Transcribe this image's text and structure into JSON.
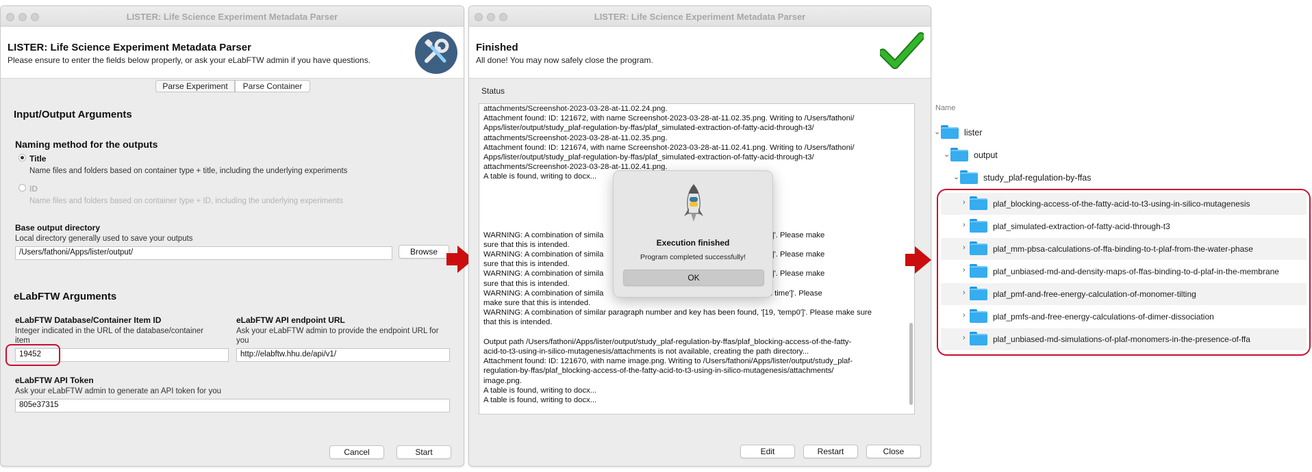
{
  "left_window": {
    "title": "LISTER: Life Science Experiment Metadata Parser",
    "header_title": "LISTER: Life Science Experiment Metadata Parser",
    "header_subtitle": "Please ensure to enter the fields below properly, or ask your eLabFTW admin if you have questions.",
    "tabs": [
      "Parse Experiment",
      "Parse Container"
    ],
    "io_section": "Input/Output Arguments",
    "naming_title": "Naming method for the outputs",
    "option_title_label": "Title",
    "option_title_desc": "Name files and folders based on container type + title, including the underlying experiments",
    "option_id_label": "ID",
    "option_id_desc": "Name files and folders based on container type + ID, including the underlying experiments",
    "base_dir_label": "Base output directory",
    "base_dir_desc": "Local directory generally used to save your outputs",
    "base_dir_value": "/Users/fathoni/Apps/lister/output/",
    "browse_label": "Browse",
    "elab_section": "eLabFTW Arguments",
    "item_id_label": "eLabFTW Database/Container Item ID",
    "item_id_desc": "Integer indicated in the URL of the database/container item",
    "item_id_value": "19452",
    "api_url_label": "eLabFTW API endpoint URL",
    "api_url_desc": "Ask your eLabFTW admin to provide the endpoint URL for you",
    "api_url_value": "http://elabftw.hhu.de/api/v1/",
    "token_label": "eLabFTW API Token",
    "token_desc": "Ask your eLabFTW admin to generate an API token for you",
    "token_value": "805e37315",
    "cancel_label": "Cancel",
    "start_label": "Start"
  },
  "middle_window": {
    "title": "LISTER: Life Science Experiment Metadata Parser",
    "header_title": "Finished",
    "header_subtitle": "All done! You may now safely close the program.",
    "status_label": "Status",
    "log_lines": [
      "attachments/Screenshot-2023-03-28-at-11.02.24.png.",
      "Attachment found: ID: 121672, with name Screenshot-2023-03-28-at-11.02.35.png. Writing to /Users/fathoni/",
      "Apps/lister/output/study_plaf-regulation-by-ffas/plaf_simulated-extraction-of-fatty-acid-through-t3/",
      "attachments/Screenshot-2023-03-28-at-11.02.35.png.",
      "Attachment found: ID: 121674, with name Screenshot-2023-03-28-at-11.02.41.png. Writing to /Users/fathoni/",
      "Apps/lister/output/study_plaf-regulation-by-ffas/plaf_simulated-extraction-of-fatty-acid-through-t3/",
      "attachments/Screenshot-2023-03-28-at-11.02.41.png.",
      "A table is found, writing to docx...",
      "",
      "",
      "",
      "",
      "",
      "WARNING: A combination of simila                                                    , '[11, 'force field']'. Please make",
      "sure that this is intended.",
      "WARNING: A combination of simila                                                    , '[11, 'force field']'. Please make",
      "sure that this is intended.",
      "WARNING: A combination of simila                                                    , '[11, 'force field']'. Please make",
      "sure that this is intended.",
      "WARNING: A combination of simila                                                    , '[19, 'simulation time']'. Please",
      "make sure that this is intended.",
      "WARNING: A combination of similar paragraph number and key has been found, '[19, 'temp0']'. Please make sure",
      "that this is intended.",
      "",
      "Output path /Users/fathoni/Apps/lister/output/study_plaf-regulation-by-ffas/plaf_blocking-access-of-the-fatty-",
      "acid-to-t3-using-in-silico-mutagenesis/attachments is not available, creating the path directory...",
      "Attachment found: ID: 121670, with name image.png. Writing to /Users/fathoni/Apps/lister/output/study_plaf-",
      "regulation-by-ffas/plaf_blocking-access-of-the-fatty-acid-to-t3-using-in-silico-mutagenesis/attachments/",
      "image.png.",
      "A table is found, writing to docx...",
      "A table is found, writing to docx..."
    ],
    "dialog_title": "Execution finished",
    "dialog_message": "Program completed successfully!",
    "dialog_ok": "OK",
    "edit_label": "Edit",
    "restart_label": "Restart",
    "close_label": "Close"
  },
  "finder": {
    "column_header": "Name",
    "root": "lister",
    "level1": "output",
    "level2": "study_plaf-regulation-by-ffas",
    "children": [
      "plaf_blocking-access-of-the-fatty-acid-to-t3-using-in-silico-mutagenesis",
      "plaf_simulated-extraction-of-fatty-acid-through-t3",
      "plaf_mm-pbsa-calculations-of-ffa-binding-to-t-plaf-from-the-water-phase",
      "plaf_unbiased-md-and-density-maps-of-ffas-binding-to-d-plaf-in-the-membrane",
      "plaf_pmf-and-free-energy-calculation-of-monomer-tilting",
      "plaf_pmfs-and-free-energy-calculations-of-dimer-dissociation",
      "plaf_unbiased-md-simulations-of-plaf-monomers-in-the-presence-of-ffa"
    ]
  },
  "colors": {
    "highlight_red": "#c8102e",
    "arrow_red": "#cc0d0d",
    "folder_blue": "#35adef",
    "check_green": "#33b52b",
    "tool_icon_bg": "#3d5f82"
  }
}
